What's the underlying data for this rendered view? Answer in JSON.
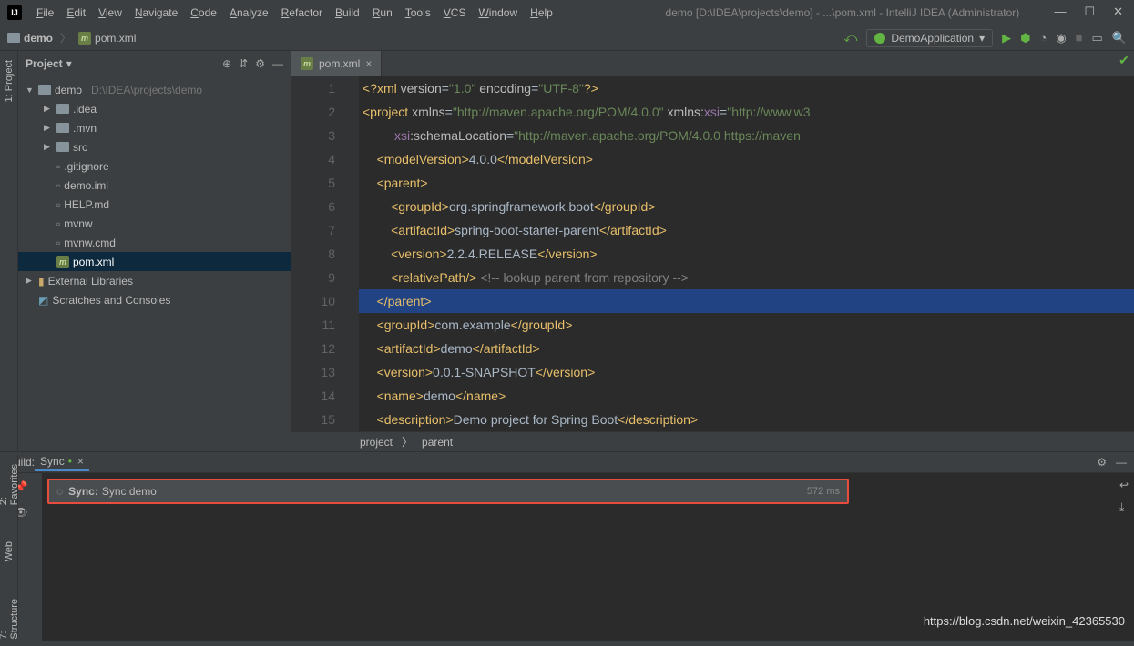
{
  "title": "demo [D:\\IDEA\\projects\\demo] - ...\\pom.xml - IntelliJ IDEA (Administrator)",
  "menu": [
    "File",
    "Edit",
    "View",
    "Navigate",
    "Code",
    "Analyze",
    "Refactor",
    "Build",
    "Run",
    "Tools",
    "VCS",
    "Window",
    "Help"
  ],
  "nav": {
    "root": "demo",
    "file": "pom.xml"
  },
  "runConfig": "DemoApplication",
  "projectPanel": {
    "title": "Project",
    "tree": [
      {
        "lvl": 0,
        "arrow": "▼",
        "icon": "folder",
        "name": "demo",
        "hint": "D:\\IDEA\\projects\\demo"
      },
      {
        "lvl": 1,
        "arrow": "▶",
        "icon": "folder",
        "name": ".idea"
      },
      {
        "lvl": 1,
        "arrow": "▶",
        "icon": "folder",
        "name": ".mvn"
      },
      {
        "lvl": 1,
        "arrow": "▶",
        "icon": "folder",
        "name": "src"
      },
      {
        "lvl": 1,
        "arrow": "",
        "icon": "file",
        "name": ".gitignore"
      },
      {
        "lvl": 1,
        "arrow": "",
        "icon": "file",
        "name": "demo.iml"
      },
      {
        "lvl": 1,
        "arrow": "",
        "icon": "file",
        "name": "HELP.md"
      },
      {
        "lvl": 1,
        "arrow": "",
        "icon": "file",
        "name": "mvnw"
      },
      {
        "lvl": 1,
        "arrow": "",
        "icon": "file",
        "name": "mvnw.cmd"
      },
      {
        "lvl": 1,
        "arrow": "",
        "icon": "m",
        "name": "pom.xml",
        "sel": true
      },
      {
        "lvl": 0,
        "arrow": "▶",
        "icon": "lib",
        "name": "External Libraries"
      },
      {
        "lvl": 0,
        "arrow": "",
        "icon": "scratch",
        "name": "Scratches and Consoles"
      }
    ]
  },
  "editorTab": "pom.xml",
  "code": {
    "lines": [
      {
        "n": 1,
        "html": "<span class='tag'>&lt;?xml</span> <span class='attr'>version</span>=<span class='str'>\"1.0\"</span> <span class='attr'>encoding</span>=<span class='str'>\"UTF-8\"</span><span class='tag'>?&gt;</span>"
      },
      {
        "n": 2,
        "html": "<span class='tag'>&lt;project</span> <span class='attr'>xmlns</span>=<span class='str'>\"http://maven.apache.org/POM/4.0.0\"</span> <span class='attr'>xmlns:</span><span class='attrname'>xsi</span>=<span class='str'>\"http://www.w3</span>"
      },
      {
        "n": 3,
        "html": "         <span class='attrname'>xsi</span><span class='attr'>:schemaLocation</span>=<span class='str'>\"http://maven.apache.org/POM/4.0.0 https://maven</span>"
      },
      {
        "n": 4,
        "html": "    <span class='tag'>&lt;modelVersion&gt;</span>4.0.0<span class='tag'>&lt;/modelVersion&gt;</span>"
      },
      {
        "n": 5,
        "html": "    <span class='tag'>&lt;parent&gt;</span>"
      },
      {
        "n": 6,
        "html": "        <span class='tag'>&lt;groupId&gt;</span>org.springframework.boot<span class='tag'>&lt;/groupId&gt;</span>"
      },
      {
        "n": 7,
        "html": "        <span class='tag'>&lt;artifactId&gt;</span>spring-boot-starter-parent<span class='tag'>&lt;/artifactId&gt;</span>"
      },
      {
        "n": 8,
        "html": "        <span class='tag'>&lt;version&gt;</span>2.2.4.RELEASE<span class='tag'>&lt;/version&gt;</span>"
      },
      {
        "n": 9,
        "html": "        <span class='tag'>&lt;relativePath/&gt;</span> <span class='cmt'>&lt;!-- lookup parent from repository --&gt;</span>"
      },
      {
        "n": 10,
        "html": "    <span class='tag'>&lt;/parent&gt;</span> ",
        "hl": true
      },
      {
        "n": 11,
        "html": "    <span class='tag'>&lt;groupId&gt;</span>com.example<span class='tag'>&lt;/groupId&gt;</span>"
      },
      {
        "n": 12,
        "html": "    <span class='tag'>&lt;artifactId&gt;</span>demo<span class='tag'>&lt;/artifactId&gt;</span>"
      },
      {
        "n": 13,
        "html": "    <span class='tag'>&lt;version&gt;</span>0.0.1-SNAPSHOT<span class='tag'>&lt;/version&gt;</span>"
      },
      {
        "n": 14,
        "html": "    <span class='tag'>&lt;name&gt;</span>demo<span class='tag'>&lt;/name&gt;</span>"
      },
      {
        "n": 15,
        "html": "    <span class='tag'>&lt;description&gt;</span>Demo project for Spring Boot<span class='tag'>&lt;/description&gt;</span>"
      }
    ]
  },
  "breadcrumbs": [
    "project",
    "parent"
  ],
  "build": {
    "label": "Build:",
    "tab": "Sync",
    "syncTitle": "Sync:",
    "syncText": "Sync demo",
    "syncTime": "572 ms"
  },
  "leftRail": [
    "1: Project"
  ],
  "leftRailBottom": [
    "2: Favorites",
    "Web",
    "7: Structure"
  ],
  "watermark": "https://blog.csdn.net/weixin_42365530"
}
